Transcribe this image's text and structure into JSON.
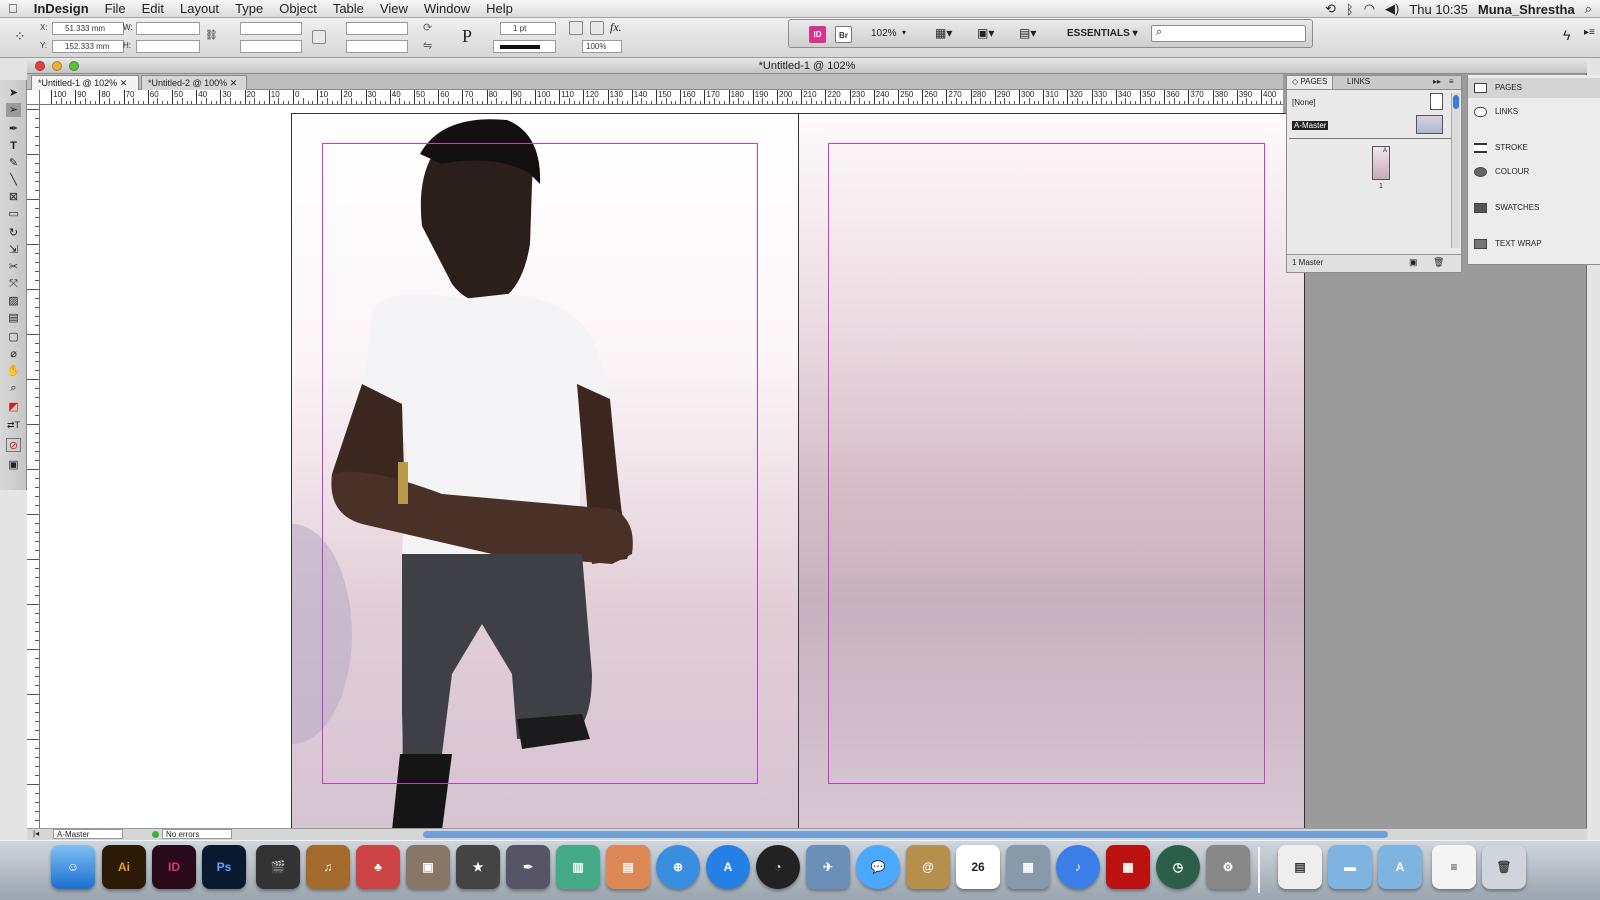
{
  "menubar": {
    "app_name": "InDesign",
    "menus": [
      "File",
      "Edit",
      "Layout",
      "Type",
      "Object",
      "Table",
      "View",
      "Window",
      "Help"
    ],
    "clock": "Thu 10:35",
    "user": "Muna_Shrestha"
  },
  "control_panel": {
    "x_label": "X:",
    "x_value": "51.333 mm",
    "y_label": "Y:",
    "y_value": "152.333 mm",
    "w_label": "W:",
    "h_label": "H:",
    "stroke_weight": "1 pt",
    "opacity": "100%",
    "fx_label": "fx."
  },
  "app_bar": {
    "id_badge": "ID",
    "br_badge": "Br",
    "zoom": "102%",
    "workspace": "ESSENTIALS ▾"
  },
  "document": {
    "window_title": "*Untitled-1 @ 102%",
    "tabs": [
      "*Untitled-1 @ 102%",
      "*Untitled-2 @ 100%"
    ],
    "ruler_labels": [
      "100",
      "90",
      "80",
      "70",
      "60",
      "50",
      "40",
      "30",
      "20",
      "10",
      "0",
      "10",
      "20",
      "30",
      "40",
      "50",
      "60",
      "70",
      "80",
      "90",
      "100",
      "110",
      "120",
      "130",
      "140",
      "150",
      "160",
      "170",
      "180",
      "190",
      "200",
      "210",
      "220",
      "230",
      "240",
      "250",
      "260",
      "270",
      "280",
      "290",
      "300",
      "310",
      "320",
      "330",
      "340",
      "350",
      "360",
      "370",
      "380",
      "390",
      "400"
    ],
    "status_page": "A-Master",
    "status_errors": "No errors"
  },
  "pages_panel": {
    "tab_pages": "PAGES",
    "tab_links": "LINKS",
    "none_label": "[None]",
    "master_label": "A-Master",
    "page_letter": "A",
    "page_number": "1",
    "footer": "1 Master"
  },
  "side_panel": {
    "items": [
      "PAGES",
      "LINKS",
      "STROKE",
      "COLOUR",
      "SWATCHES",
      "TEXT WRAP"
    ]
  },
  "dock": {
    "items": [
      "Finder",
      "Ai",
      "ID",
      "Ps",
      "Clapboard",
      "Guitar",
      "Gnome",
      "Photo",
      "Movie",
      "Quill",
      "Chart",
      "Keynote",
      "Safari",
      "App Store",
      "Dashboard",
      "Eagle",
      "Chat",
      "Address",
      "26",
      "Photobooth",
      "iTunes",
      "Theater",
      "Time",
      "Prefs",
      "Files",
      "Folder",
      "Folder2",
      "Doc",
      "Trash"
    ],
    "calendar_day": "26",
    "ai_label": "Ai",
    "id_label": "ID",
    "ps_label": "Ps"
  },
  "colors": {
    "margin_guide": "#c33bd0",
    "id_brand": "#d6338f",
    "ai_brand": "#f29a1c",
    "ps_brand": "#2c6fc1"
  }
}
